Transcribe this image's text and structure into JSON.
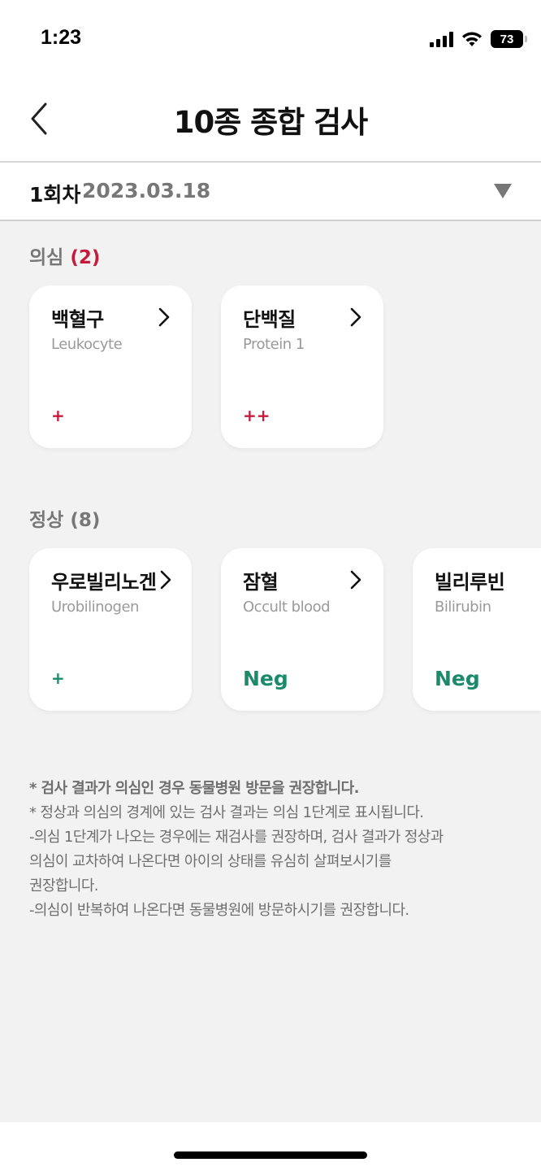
{
  "status_bar": {
    "time": "1:23",
    "battery": "73"
  },
  "header": {
    "title": "10종 종합 검사",
    "back_icon": "chevron-left-icon"
  },
  "session": {
    "round": "1회차",
    "date": "2023.03.18",
    "dropdown_icon": "triangle-down-icon"
  },
  "suspect_section": {
    "label": "의심",
    "count": "(2)",
    "items": [
      {
        "name": "백혈구",
        "name_en": "Leukocyte",
        "result": "+"
      },
      {
        "name": "단백질",
        "name_en": "Protein 1",
        "result": "++"
      }
    ]
  },
  "normal_section": {
    "label": "정상",
    "count": "(8)",
    "items": [
      {
        "name": "우로빌리노겐",
        "name_en": "Urobilinogen",
        "result": "+"
      },
      {
        "name": "잠혈",
        "name_en": "Occult blood",
        "result": "Neg"
      },
      {
        "name": "빌리루빈",
        "name_en": "Bilirubin",
        "result": "Neg"
      }
    ]
  },
  "notes": {
    "line1": "* 검사 결과가 의심인 경우 동물병원 방문을 권장합니다.",
    "line2": "* 정상과 의심의 경계에 있는 검사 결과는 의심 1단계로 표시됩니다.",
    "line3": "-의심 1단계가 나오는 경우에는 재검사를 권장하며, 검사 결과가 정상과",
    "line4": "의심이 교차하여 나온다면 아이의 상태를 유심히 살펴보시기를",
    "line5": "권장합니다.",
    "line6": "-의심이 반복하여 나온다면 동물병원에 방문하시기를 권장합니다."
  },
  "colors": {
    "suspect": "#c8193c",
    "normal": "#1a8a6a",
    "background": "#f2f2f2"
  }
}
